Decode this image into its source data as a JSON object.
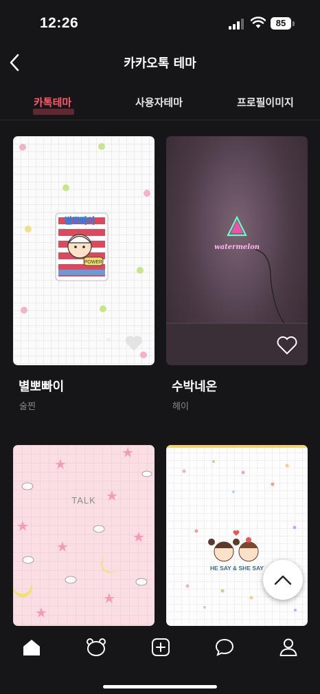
{
  "status_bar": {
    "time": "12:26",
    "battery": "85"
  },
  "header": {
    "title": "카카오톡 테마",
    "back_icon": "chevron-left-icon"
  },
  "tabs": [
    {
      "label": "카톡테마",
      "active": true
    },
    {
      "label": "사용자테마",
      "active": false
    },
    {
      "label": "프로필이미지",
      "active": false
    }
  ],
  "themes": [
    {
      "name": "별뽀빠이",
      "author": "술찐",
      "card_text": "별뽀빠이",
      "sub_text": "POWER"
    },
    {
      "name": "수박네온",
      "author": "헤이",
      "card_text": "watermelon"
    },
    {
      "name": "",
      "author": "",
      "card_text": "TALK"
    },
    {
      "name": "",
      "author": "",
      "card_text": "HE SAY & SHE SAY"
    }
  ],
  "bottom_nav": [
    "home-icon",
    "bear-face-icon",
    "add-square-icon",
    "chat-bubble-icon",
    "person-icon"
  ],
  "colors": {
    "accent": "#ff5a6e",
    "background": "#161618"
  }
}
